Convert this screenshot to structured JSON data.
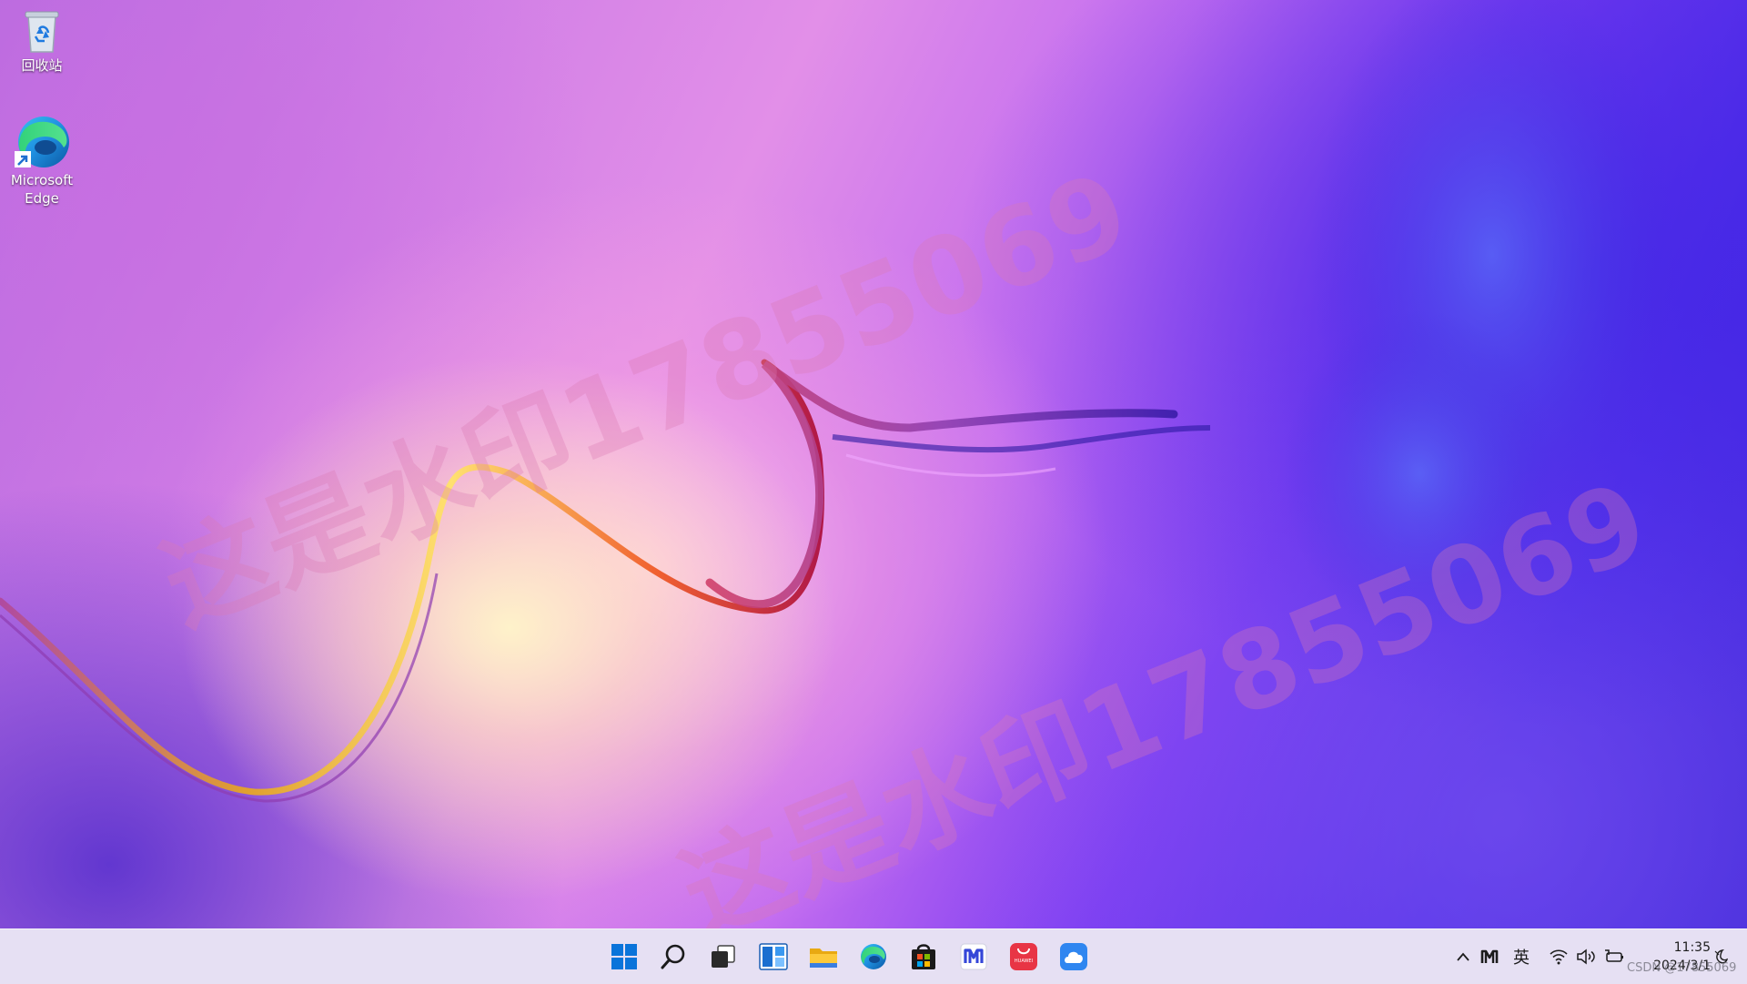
{
  "desktop": {
    "icons": [
      {
        "label": "回收站",
        "icon": "recycle-bin-icon"
      },
      {
        "label": "Microsoft\nEdge",
        "icon": "edge-icon"
      }
    ],
    "watermarks": [
      "这是水印17855069",
      "这是水印17855069"
    ]
  },
  "taskbar": {
    "apps": [
      {
        "name": "start",
        "icon": "windows-logo-icon"
      },
      {
        "name": "search",
        "icon": "search-icon"
      },
      {
        "name": "task-view",
        "icon": "task-view-icon"
      },
      {
        "name": "widgets",
        "icon": "widgets-icon"
      },
      {
        "name": "file-explorer",
        "icon": "folder-icon"
      },
      {
        "name": "edge",
        "icon": "edge-icon"
      },
      {
        "name": "store",
        "icon": "store-icon"
      },
      {
        "name": "mmm",
        "icon": "m-app-icon"
      },
      {
        "name": "huawei-appgallery",
        "icon": "huawei-icon",
        "badge": "HUAWEI"
      },
      {
        "name": "cloud",
        "icon": "cloud-icon"
      }
    ],
    "tray": {
      "overflow_icon": "chevron-up-icon",
      "m_icon": "m-tray-icon",
      "ime": "英",
      "wifi_icon": "wifi-icon",
      "volume_icon": "volume-icon",
      "battery_icon": "battery-icon",
      "time": "11:35",
      "date": "2024/3/1",
      "notification_icon": "moon-icon"
    }
  },
  "credit": "CSDN @17855069",
  "colors": {
    "taskbar_bg": "#e6e0f3",
    "accent_blue": "#0a66d8",
    "huawei_red": "#e83545"
  }
}
